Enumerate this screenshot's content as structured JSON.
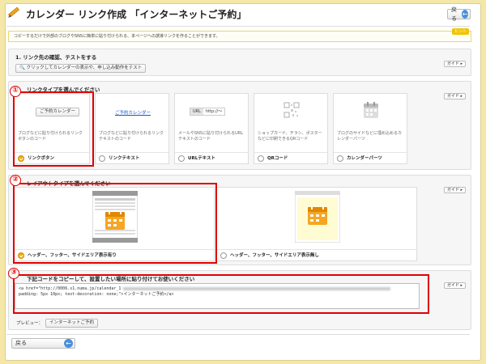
{
  "header": {
    "title": "カレンダー リンク作成 「インターネットご予約」",
    "back_label": "戻る"
  },
  "info": {
    "text": "コピーするだけで外部のブログやSNSに簡単に貼り付けられる、本ページへの誘導リンクを作ることができます。",
    "tag": "ヒント"
  },
  "section1": {
    "title": "1. リンク先の確認、テストをする",
    "button": "クリックしてカレンダーの表示や、申し込み動作をテスト",
    "guide": "ガイド"
  },
  "section2": {
    "title": "リンクタイプを選んでください",
    "guide": "ガイド",
    "cards": [
      {
        "preview": "ご予約カレンダー",
        "desc": "ブログなどに貼り付けられるリンクボタンのコード",
        "label": "リンクボタン",
        "selected": true
      },
      {
        "preview": "ご予約カレンダー",
        "desc": "ブログなどに貼り付けられるリンクテキストのコード",
        "label": "リンクテキスト",
        "selected": false
      },
      {
        "preview_tag": "URL",
        "preview": "http://～",
        "desc": "メールやSNSに貼り付けられるURLテキストのコード",
        "label": "URLテキスト",
        "selected": false
      },
      {
        "desc": "ショップカード、チラシ、ポスターなどに印刷できるQRコード",
        "label": "QRコード",
        "selected": false
      },
      {
        "desc": "ブログのサイドなどに埋め込めるカレンダーパーツ",
        "label": "カレンダーパーツ",
        "selected": false
      }
    ]
  },
  "section3": {
    "title": "レイアウトタイプを選んでください",
    "guide": "ガイド",
    "cards": [
      {
        "label": "ヘッダー、フッター、サイドエリア表示有り",
        "selected": true
      },
      {
        "label": "ヘッダー、フッター、サイドエリア表示無し",
        "selected": false
      }
    ]
  },
  "section4": {
    "title": "下記コードをコピーして、設置したい場所に貼り付けてお使いください",
    "guide": "ガイド",
    "code_line1": "<a href=\"http://0006.s1.numa.jp/calendar_1",
    "code_line2": "padding: 5px 10px; text-decoration: none;\">インターネットご予約</a>",
    "preview_label": "プレビュー：",
    "preview_button": "インターネットご予約"
  },
  "annotations": [
    "①",
    "②",
    "③"
  ],
  "colors": {
    "accent": "#f0b000",
    "highlight": "#e00000",
    "link": "#1a56c8",
    "background": "#f4e7a8"
  },
  "footer": {
    "back_label": "戻る"
  }
}
